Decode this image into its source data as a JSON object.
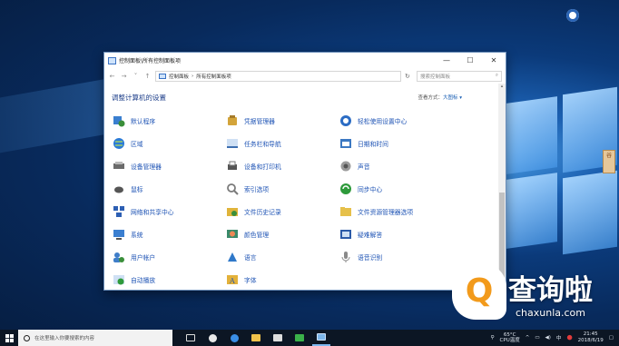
{
  "window": {
    "title": "控制面板\\所有控制面板项",
    "buttons": {
      "minimize": "—",
      "maximize": "☐",
      "close": "✕"
    },
    "address": [
      "控制面板",
      "›",
      "所有控制面板项"
    ],
    "search_placeholder": "搜索控制面板",
    "heading": "调整计算机的设置",
    "view_by_label": "查看方式：",
    "view_by_value": "大图标 ▾"
  },
  "items": [
    {
      "label": "默认程序",
      "icon": "default-programs-icon",
      "color": "#3a8f3a"
    },
    {
      "label": "凭据管理器",
      "icon": "credential-manager-icon",
      "color": "#d3a43a"
    },
    {
      "label": "轻松使用设置中心",
      "icon": "ease-of-access-icon",
      "color": "#2b6cc4"
    },
    {
      "label": "区域",
      "icon": "region-globe-icon",
      "color": "#2b7bd6"
    },
    {
      "label": "任务栏和导航",
      "icon": "taskbar-navigation-icon",
      "color": "#3d6fb0"
    },
    {
      "label": "日期和时间",
      "icon": "date-time-icon",
      "color": "#3b78c2"
    },
    {
      "label": "设备管理器",
      "icon": "device-manager-icon",
      "color": "#6b6b6b"
    },
    {
      "label": "设备和打印机",
      "icon": "devices-printers-icon",
      "color": "#555555"
    },
    {
      "label": "声音",
      "icon": "sound-speaker-icon",
      "color": "#9b9b9b"
    },
    {
      "label": "鼠标",
      "icon": "mouse-icon",
      "color": "#555555"
    },
    {
      "label": "索引选项",
      "icon": "indexing-options-icon",
      "color": "#7a7a7a"
    },
    {
      "label": "同步中心",
      "icon": "sync-center-icon",
      "color": "#2e9a3b"
    },
    {
      "label": "网络和共享中心",
      "icon": "network-sharing-icon",
      "color": "#2d5fb3"
    },
    {
      "label": "文件历史记录",
      "icon": "file-history-icon",
      "color": "#e0b43a"
    },
    {
      "label": "文件资源管理器选项",
      "icon": "file-explorer-options-icon",
      "color": "#e6c04a"
    },
    {
      "label": "系统",
      "icon": "system-icon",
      "color": "#3b7fd0"
    },
    {
      "label": "颜色管理",
      "icon": "color-management-icon",
      "color": "#3a8a6a"
    },
    {
      "label": "疑难解答",
      "icon": "troubleshooting-icon",
      "color": "#2b5aa8"
    },
    {
      "label": "用户帐户",
      "icon": "user-accounts-icon",
      "color": "#3f7ec9"
    },
    {
      "label": "语言",
      "icon": "language-icon",
      "color": "#2f78c9"
    },
    {
      "label": "语音识别",
      "icon": "speech-recognition-icon",
      "color": "#8a8a8a"
    },
    {
      "label": "自动播放",
      "icon": "autoplay-icon",
      "color": "#2e9a3b"
    },
    {
      "label": "字体",
      "icon": "fonts-icon",
      "color": "#e3b13a"
    }
  ],
  "taskbar": {
    "search_text": "在这里输入你要搜索的内容",
    "temperature": "65°C",
    "temp_label": "CPU温度",
    "time": "21:45",
    "date": "2018/6/19"
  },
  "side_note": "谷",
  "watermark": {
    "cn": "查询啦",
    "url": "chaxunla.com"
  }
}
